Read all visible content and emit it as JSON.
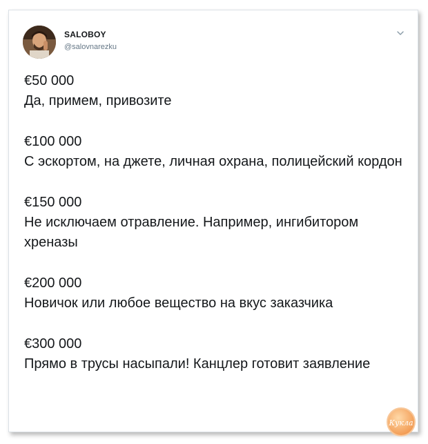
{
  "tweet": {
    "author_name": "SALOBOY",
    "author_handle": "@salovnarezku",
    "blocks": [
      {
        "price": "€50 000",
        "text": "Да, примем, привозите"
      },
      {
        "price": "€100 000",
        "text": "С эскортом, на джете, личная охрана, полицейский кордон"
      },
      {
        "price": "€150 000",
        "text": "Не исключаем отравление. Например, ингибитором хреназы"
      },
      {
        "price": "€200 000",
        "text": "Новичок или любое вещество на вкус заказчика"
      },
      {
        "price": "€300 000",
        "text": "Прямо в трусы насыпали! Канцлер готовит заявление"
      }
    ]
  },
  "icons": {
    "menu": "chevron-down-icon",
    "avatar": "user-avatar",
    "watermark": "site-logo"
  },
  "watermark": {
    "text": "Кукла"
  },
  "colors": {
    "text": "#14171a",
    "handle": "#657786",
    "border": "#dbe1e6",
    "logo": "#f5a25d"
  }
}
